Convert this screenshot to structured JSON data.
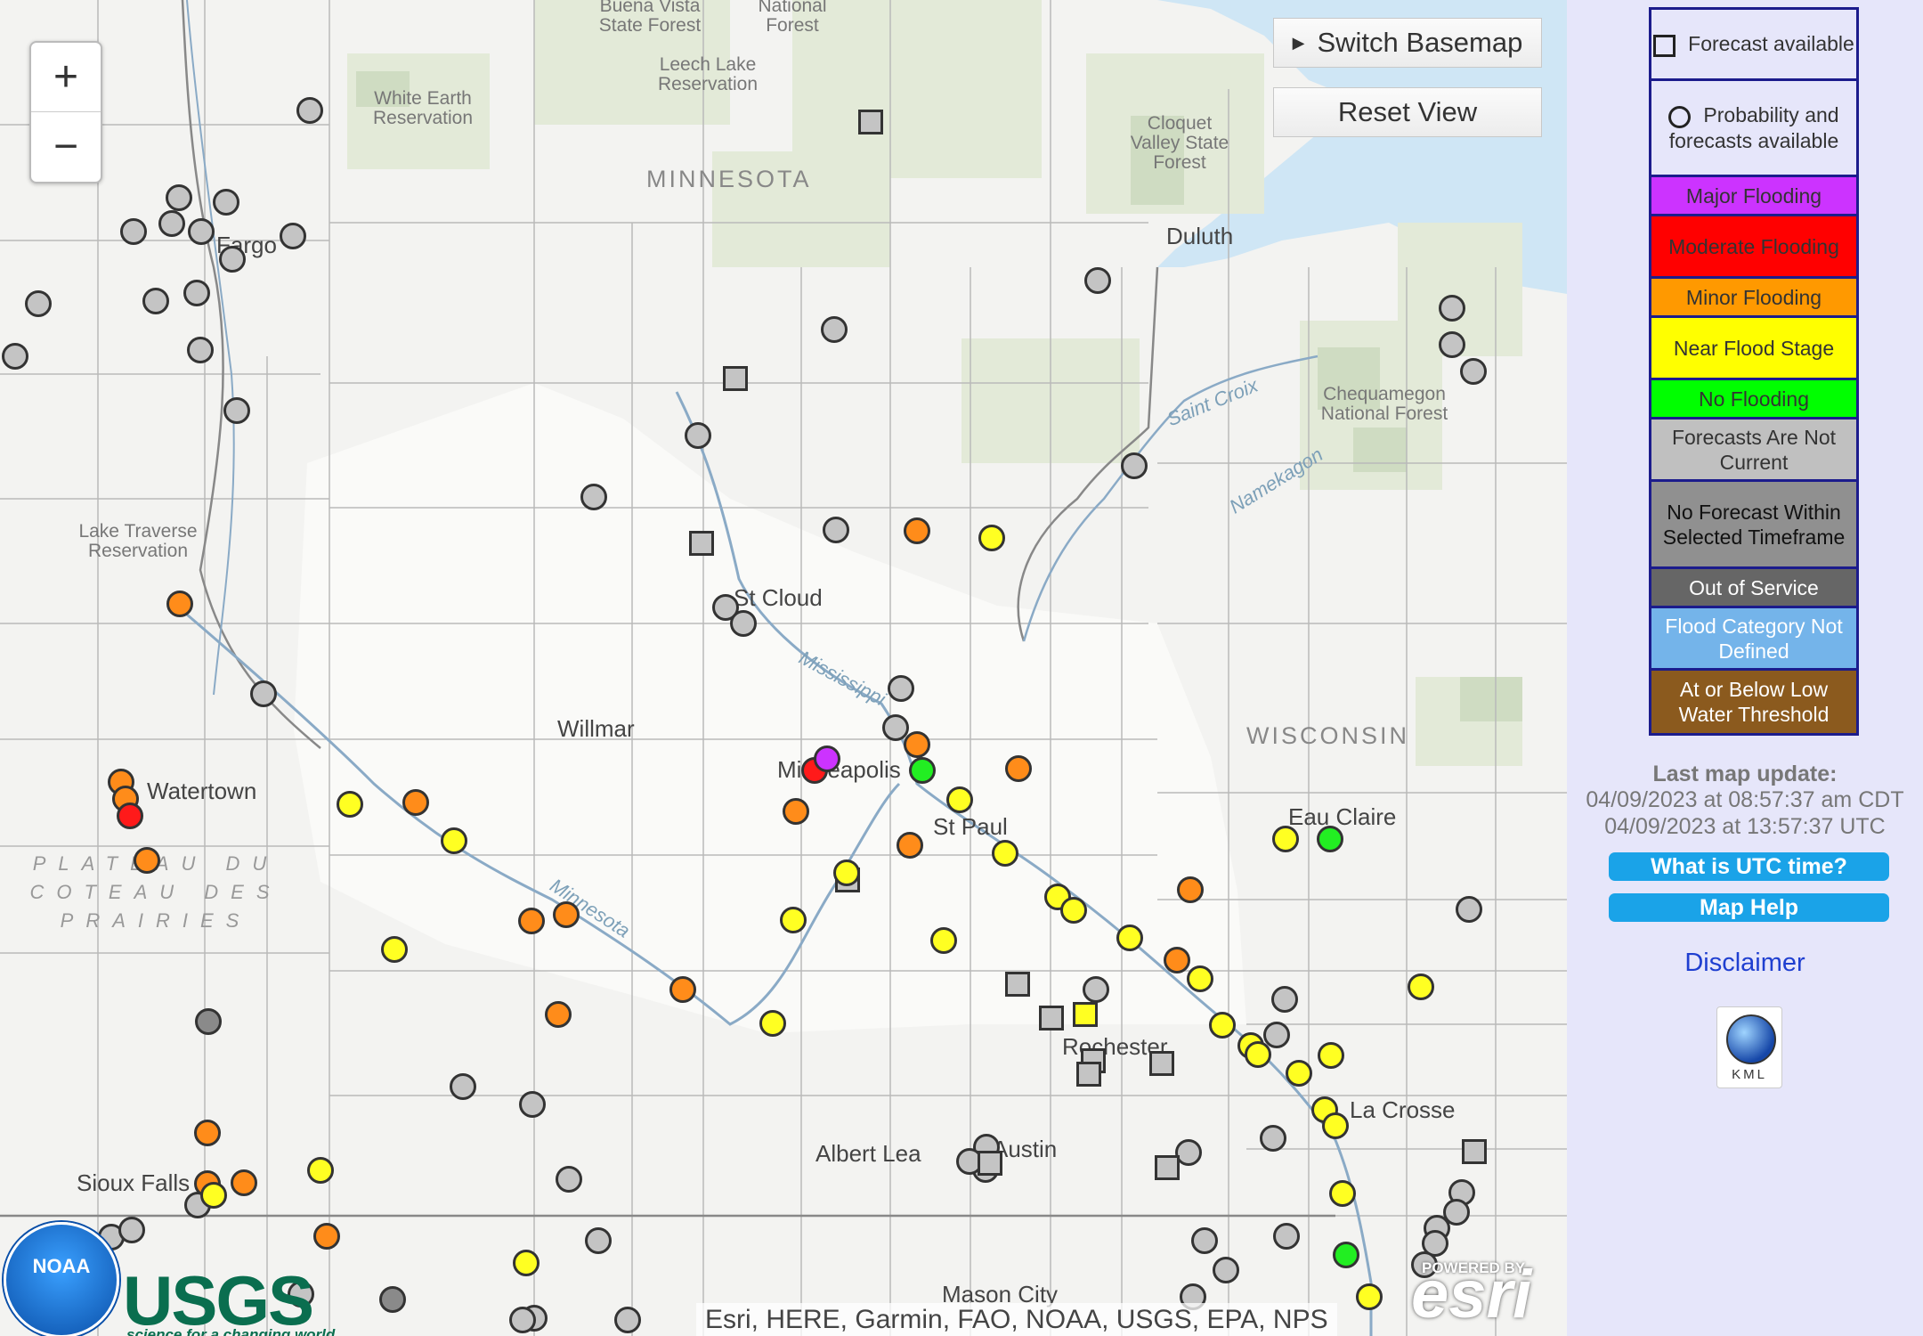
{
  "map": {
    "zoom_in_label": "+",
    "zoom_out_label": "−",
    "switch_basemap_label": "Switch Basemap",
    "reset_view_label": "Reset View",
    "attribution": "Esri, HERE, Garmin, FAO, NOAA, USGS, EPA, NPS",
    "states": [
      "MINNESOTA",
      "WISCONSIN"
    ],
    "cities": [
      "Fargo",
      "Duluth",
      "St Cloud",
      "Willmar",
      "Minneapolis",
      "St Paul",
      "Watertown",
      "Eau Claire",
      "Rochester",
      "La Crosse",
      "Albert Lea",
      "Austin",
      "Sioux Falls",
      "Mason City"
    ],
    "areas": [
      "White Earth Reservation",
      "Leech Lake Reservation",
      "Buena Vista State Forest",
      "National Forest",
      "Cloquet Valley State Forest",
      "Chequamegon National Forest",
      "Lake Traverse Reservation"
    ],
    "plateau_text": [
      "PLATEAU DU",
      "COTEAU DES",
      "PRAIRIES"
    ],
    "water": [
      "Mississippi",
      "Minnesota",
      "Saint Croix",
      "Namekagon"
    ],
    "logos": {
      "noaa": "NOAA",
      "usgs": "USGS",
      "usgs_tagline": "science for a changing world",
      "esri": "esri",
      "esri_tagline": "POWERED BY"
    }
  },
  "legend": {
    "forecast_available": "Forecast available",
    "probability": "Probability and forecasts available",
    "major": "Major Flooding",
    "moderate": "Moderate Flooding",
    "minor": "Minor Flooding",
    "near": "Near Flood Stage",
    "no_flooding": "No Flooding",
    "not_current": "Forecasts Are Not Current",
    "no_forecast": "No Forecast Within Selected Timeframe",
    "out_of_service": "Out of Service",
    "not_defined": "Flood Category Not Defined",
    "low_water": "At or Below Low Water Threshold",
    "colors": {
      "major": "#cc33ff",
      "moderate": "#ff0000",
      "minor": "#ff9900",
      "near": "#ffff00",
      "no_flooding": "#00ff00",
      "not_current": "#c0c0c0",
      "no_forecast": "#909090",
      "out_of_service": "#666666",
      "not_defined": "#74b4ea",
      "low_water": "#8b5a1e"
    }
  },
  "update": {
    "title": "Last map update:",
    "local": "04/09/2023 at 08:57:37 am CDT",
    "utc": "04/09/2023 at 13:57:37 UTC"
  },
  "buttons": {
    "utc": "What is UTC time?",
    "help": "Map Help",
    "disclaimer": "Disclaimer",
    "kml": "KML"
  }
}
